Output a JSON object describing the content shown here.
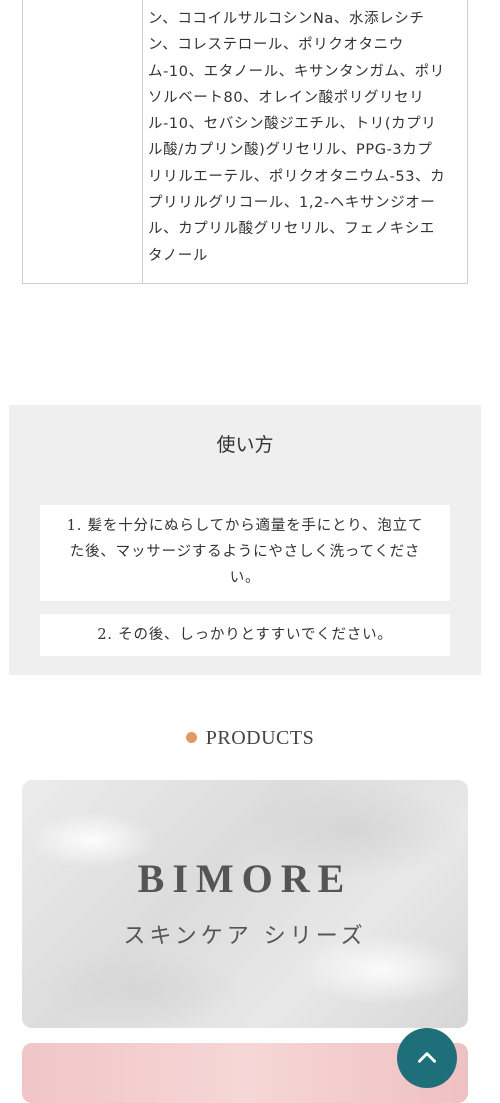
{
  "ingredients": {
    "lines": [
      "ン、ココイルサルコシンNa、水添レシチ",
      "ン、コレステロール、ポリクオタニウ",
      "ム-10、エタノール、キサンタンガム、ポリ",
      "ソルベート80、オレイン酸ポリグリセリ",
      "ル-10、セバシン酸ジエチル、トリ(カプリ",
      "ル酸/カプリン酸)グリセリル、PPG-3カプ",
      "リリルエーテル、ポリクオタニウム-53、カ",
      "プリリルグリコール、1,2-ヘキサンジオー",
      "ル、カプリル酸グリセリル、フェノキシエ",
      "タノール"
    ]
  },
  "usage": {
    "title": "使い方",
    "step1_lines": [
      "1. 髪を十分にぬらしてから適量を手にとり、泡立て",
      "た後、マッサージするようにやさしく洗ってくださ",
      "い。"
    ],
    "step2": "2. その後、しっかりとすすいでください。"
  },
  "products": {
    "heading": "PRODUCTS",
    "dot_color": "#e09a62"
  },
  "banner": {
    "title": "BIMORE",
    "subtitle": "スキンケア シリーズ"
  },
  "back_to_top": {
    "icon": "chevron-up-icon",
    "color": "#1f6f7a"
  }
}
